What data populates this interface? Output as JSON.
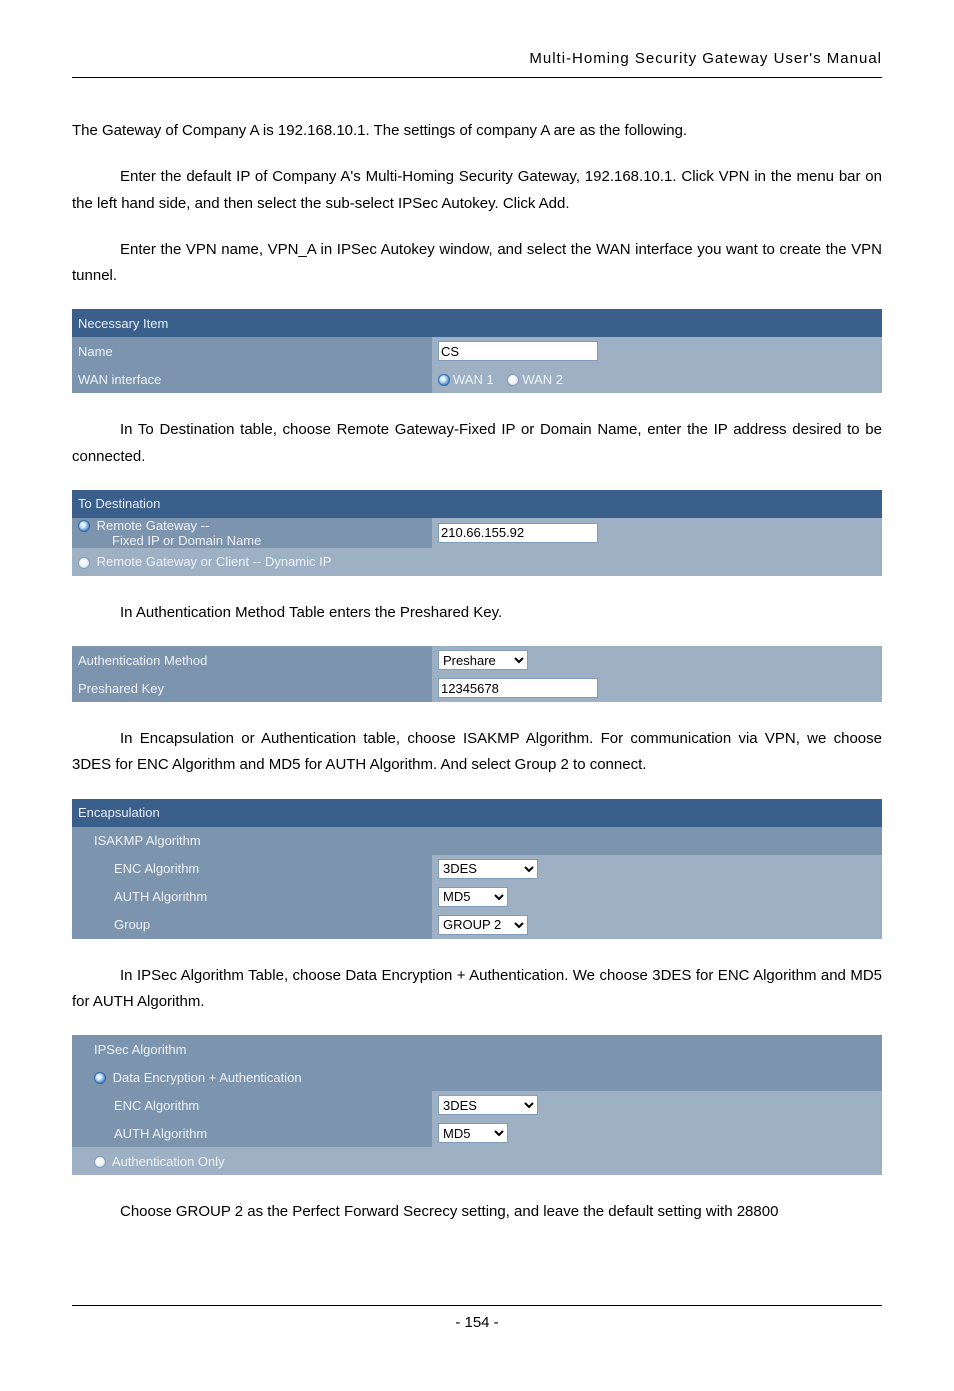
{
  "header": {
    "title": "Multi-Homing  Security  Gateway  User's  Manual"
  },
  "p1": "The Gateway of Company A is 192.168.10.1. The settings of company A are as the following.",
  "p2": "Enter the default IP of Company A's Multi-Homing Security Gateway, 192.168.10.1. Click VPN in the menu bar on the left hand side, and then select the sub-select IPSec Autokey. Click Add.",
  "p3": "Enter the VPN name, VPN_A in IPSec Autokey window, and select the WAN interface you want to create the VPN tunnel.",
  "table1": {
    "header": "Necessary Item",
    "name_label": "Name",
    "name_value": "CS",
    "wan_label": "WAN interface",
    "wan1": "WAN 1",
    "wan2": "WAN 2"
  },
  "p4": "In To Destination table, choose Remote Gateway-Fixed IP or Domain Name, enter the IP address desired to be connected.",
  "table2": {
    "header": "To Destination",
    "row1a": "Remote Gateway --",
    "row1b": "Fixed IP or Domain Name",
    "row1_value": "210.66.155.92",
    "row2": "Remote Gateway or Client -- Dynamic IP"
  },
  "p5": "In Authentication Method Table enters the Preshared Key.",
  "table3": {
    "row1_label": "Authentication Method",
    "row1_value": "Preshare",
    "row2_label": "Preshared Key",
    "row2_value": "12345678"
  },
  "p6": "In Encapsulation or Authentication table, choose ISAKMP Algorithm. For communication via VPN, we choose 3DES for ENC Algorithm and MD5 for AUTH Algorithm. And select Group 2 to connect.",
  "table4": {
    "header": "Encapsulation",
    "sub1": "ISAKMP Algorithm",
    "enc_label": "ENC Algorithm",
    "enc_value": "3DES",
    "auth_label": "AUTH Algorithm",
    "auth_value": "MD5",
    "group_label": "Group",
    "group_value": "GROUP 2"
  },
  "p7": "In IPSec Algorithm Table, choose Data Encryption + Authentication. We choose 3DES for ENC Algorithm and MD5 for AUTH Algorithm.",
  "table5": {
    "header": "IPSec Algorithm",
    "sub1": "Data Encryption + Authentication",
    "enc_label": "ENC Algorithm",
    "enc_value": "3DES",
    "auth_label": "AUTH Algorithm",
    "auth_value": "MD5",
    "sub2": "Authentication Only"
  },
  "p8": "Choose GROUP 2 as the Perfect Forward Secrecy setting, and leave the default setting with 28800",
  "footer": {
    "page": "- 154 -"
  }
}
